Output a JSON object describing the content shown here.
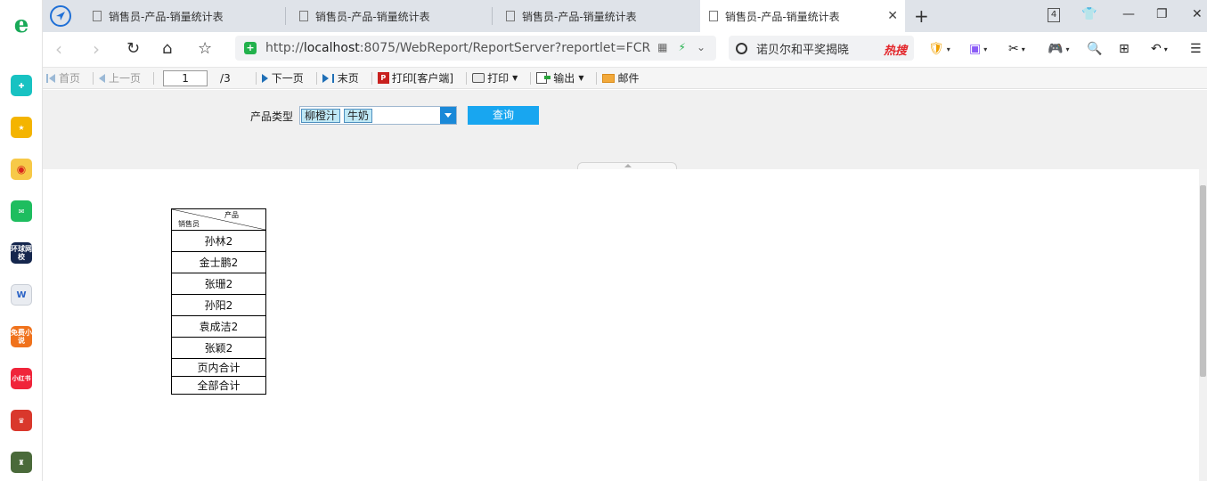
{
  "browser": {
    "tabs": [
      {
        "label": "销售员-产品-销量统计表"
      },
      {
        "label": "销售员-产品-销量统计表"
      },
      {
        "label": "销售员-产品-销量统计表"
      },
      {
        "label": "销售员-产品-销量统计表",
        "active": true
      }
    ],
    "tab_count": "4",
    "url_scheme": "http://",
    "url_host": "localhost",
    "url_rest": ":8075/WebReport/ReportServer?reportlet=FCR",
    "search_text": "诺贝尔和平奖揭晓",
    "search_badge": "热搜"
  },
  "toolbar": {
    "first": "首页",
    "prev": "上一页",
    "page_value": "1",
    "page_total": "/3",
    "next": "下一页",
    "last": "末页",
    "print_client": "打印[客户端]",
    "print": "打印",
    "export": "输出",
    "mail": "邮件"
  },
  "params": {
    "label": "产品类型",
    "selected": [
      "柳橙汁",
      "牛奶"
    ],
    "query": "查询"
  },
  "report": {
    "header_top": "产品",
    "header_bottom": "销售员",
    "rows": [
      "孙林2",
      "金士鹏2",
      "张珊2",
      "孙阳2",
      "袁成洁2",
      "张颖2"
    ],
    "page_total": "页内合计",
    "grand_total": "全部合计"
  },
  "sidebar": {
    "apps": [
      "环球网校",
      "免费小说",
      "小红书"
    ]
  }
}
